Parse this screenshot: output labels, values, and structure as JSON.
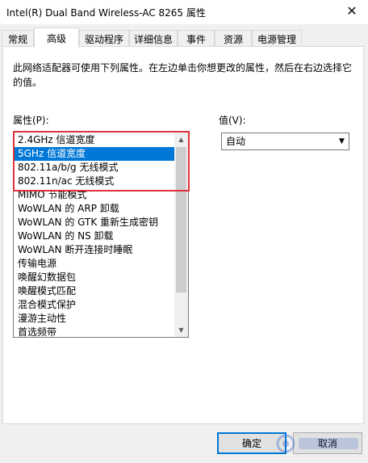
{
  "window": {
    "title": "Intel(R) Dual Band Wireless-AC 8265 属性",
    "close_glyph": "✕"
  },
  "tabs": [
    {
      "label": "常规"
    },
    {
      "label": "高级"
    },
    {
      "label": "驱动程序"
    },
    {
      "label": "详细信息"
    },
    {
      "label": "事件"
    },
    {
      "label": "资源"
    },
    {
      "label": "电源管理"
    }
  ],
  "active_tab": "高级",
  "panel": {
    "description": "此网络适配器可使用下列属性。在左边单击你想更改的属性，然后在右边选择它的值。",
    "property_label": "属性(P):",
    "value_label": "值(V):"
  },
  "properties": [
    "2.4GHz 信道宽度",
    "5GHz 信道宽度",
    "802.11a/b/g 无线模式",
    "802.11n/ac 无线模式",
    "MIMO 节能模式",
    "WoWLAN 的 ARP 卸载",
    "WoWLAN 的 GTK 重新生成密钥",
    "WoWLAN 的 NS 卸载",
    "WoWLAN 断开连接时睡眠",
    "传输电源",
    "唤醒幻数据包",
    "唤醒模式匹配",
    "混合模式保护",
    "漫游主动性",
    "首选频带"
  ],
  "selected_property_index": 1,
  "value_select": {
    "selected": "自动"
  },
  "buttons": {
    "ok": "确定",
    "cancel": "取消"
  },
  "colors": {
    "selection": "#0078d7",
    "highlight_box": "#e0333b"
  },
  "icons": {
    "scroll_up": "▲",
    "scroll_down": "▼",
    "dropdown": "▼"
  }
}
